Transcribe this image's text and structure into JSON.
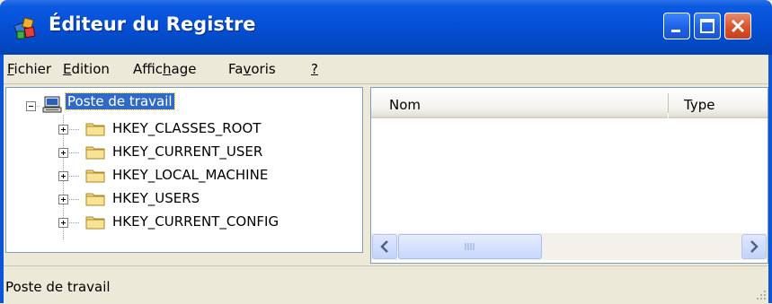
{
  "window": {
    "title": "Éditeur du Registre",
    "icon": "regedit-icon",
    "controls": [
      "minimize-icon",
      "maximize-icon",
      "close-icon"
    ]
  },
  "menu": [
    {
      "prefix": "",
      "key": "F",
      "rest": "ichier"
    },
    {
      "prefix": "",
      "key": "E",
      "rest": "dition"
    },
    {
      "prefix": "Affic",
      "key": "h",
      "rest": "age"
    },
    {
      "prefix": "Fa",
      "key": "v",
      "rest": "oris"
    },
    {
      "prefix": "",
      "key": "?",
      "rest": ""
    }
  ],
  "tree": {
    "root": {
      "label": "Poste de travail",
      "icon": "computer-icon",
      "expanded": true,
      "selected": true
    },
    "hives": [
      {
        "label": "HKEY_CLASSES_ROOT",
        "icon": "folder-icon",
        "expanded": false
      },
      {
        "label": "HKEY_CURRENT_USER",
        "icon": "folder-icon",
        "expanded": false
      },
      {
        "label": "HKEY_LOCAL_MACHINE",
        "icon": "folder-icon",
        "expanded": false
      },
      {
        "label": "HKEY_USERS",
        "icon": "folder-icon",
        "expanded": false
      },
      {
        "label": "HKEY_CURRENT_CONFIG",
        "icon": "folder-icon",
        "expanded": false
      }
    ]
  },
  "list": {
    "columns": [
      "Nom",
      "Type"
    ]
  },
  "status": {
    "text": "Poste de travail"
  },
  "colors": {
    "titlebar": "#0550d6",
    "selection": "#316ac5",
    "chrome": "#ece9d8",
    "close_button": "#d9532d"
  }
}
